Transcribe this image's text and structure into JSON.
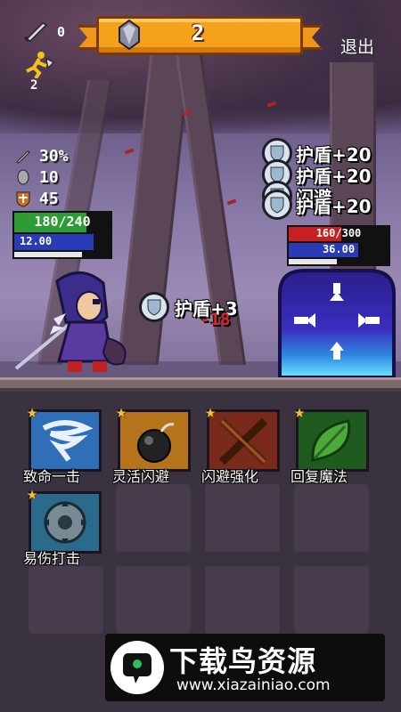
{
  "hud": {
    "sword_count": "0",
    "runner_count": "2",
    "gem_count": "2",
    "quit_label": "退出"
  },
  "player": {
    "crit": "30%",
    "defense": "10",
    "attack": "45",
    "hp_text": "180/240",
    "shield_text": "12.00",
    "hp_fraction": 0.75
  },
  "enemy": {
    "hp_text": "160/300",
    "shield_text": "36.00",
    "hp_fraction": 0.53,
    "buffs": [
      "护盾+20",
      "护盾+20",
      "闪避",
      "护盾+20"
    ]
  },
  "effects": {
    "player_shield": "护盾+3",
    "damage": "-18"
  },
  "skills": [
    {
      "label": "致命一击",
      "icon": "tornado-icon",
      "color": "#2f6fb8"
    },
    {
      "label": "灵活闪避",
      "icon": "bomb-icon",
      "color": "#b5731c"
    },
    {
      "label": "闪避强化",
      "icon": "crossed-swords-icon",
      "color": "#7a2a1a"
    },
    {
      "label": "回复魔法",
      "icon": "leaf-icon",
      "color": "#2a7a2a"
    },
    {
      "label": "易伤打击",
      "icon": "sawblade-icon",
      "color": "#2a6a8a"
    }
  ],
  "watermark": {
    "title": "下载鸟资源",
    "url": "www.xiazainiao.com"
  }
}
